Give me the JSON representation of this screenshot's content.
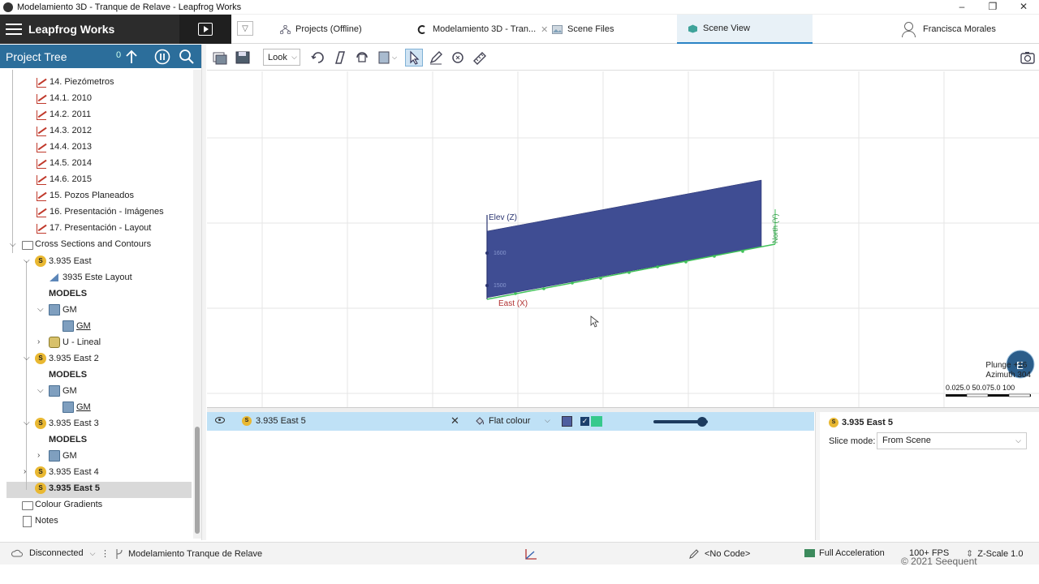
{
  "window": {
    "title": "Modelamiento 3D - Tranque de Relave - Leapfrog Works",
    "controls": [
      "–",
      "❐",
      "✕"
    ]
  },
  "header": {
    "brand": "Leapfrog Works",
    "tabs": {
      "projects": "Projects (Offline)",
      "model": "Modelamiento 3D - Tran...",
      "files": "Scene Files",
      "scene": "Scene View"
    },
    "user": "Francisca Morales"
  },
  "project_tree": {
    "title": "Project Tree",
    "count": "0",
    "items": [
      {
        "label": "14. Piezómetros"
      },
      {
        "label": "14.1. 2010"
      },
      {
        "label": "14.2. 2011"
      },
      {
        "label": "14.3. 2012"
      },
      {
        "label": "14.4. 2013"
      },
      {
        "label": "14.5. 2014"
      },
      {
        "label": "14.6. 2015"
      },
      {
        "label": "15. Pozos Planeados"
      },
      {
        "label": "16. Presentación - Imágenes"
      },
      {
        "label": "17. Presentación - Layout"
      },
      {
        "label": "Cross Sections and Contours"
      },
      {
        "label": "3.935 East"
      },
      {
        "label": "3935 Este Layout"
      },
      {
        "label": "MODELS"
      },
      {
        "label": "GM"
      },
      {
        "label": "GM"
      },
      {
        "label": "U - Lineal"
      },
      {
        "label": "3.935 East 2"
      },
      {
        "label": "MODELS"
      },
      {
        "label": "GM"
      },
      {
        "label": "GM"
      },
      {
        "label": "3.935 East 3"
      },
      {
        "label": "MODELS"
      },
      {
        "label": "GM"
      },
      {
        "label": "3.935 East 4"
      },
      {
        "label": "3.935 East 5"
      },
      {
        "label": "Colour Gradients"
      },
      {
        "label": "Notes"
      }
    ]
  },
  "toolbar": {
    "look": "Look"
  },
  "scene": {
    "axis_elev": "Elev (Z)",
    "axis_east": "East (X)",
    "axis_north": "North (Y)",
    "tick1": "1600",
    "tick2": "1500",
    "plunge": "Plunge +16",
    "azimuth": "Azimuth 304",
    "scale_labels": "0.025.0 50.075.0 100",
    "compass_letter": "E",
    "plane_color": "#3f4d93"
  },
  "shapes": {
    "name": "3.935 East 5",
    "section_badge": "S",
    "mode": "Flat colour",
    "colour": "#4f5fa0",
    "checked": "✓",
    "accent": "#36c98c",
    "opacity": 0.9
  },
  "properties": {
    "title": "3.935 East 5",
    "slice_mode_label": "Slice mode:",
    "slice_mode_value": "From Scene"
  },
  "statusbar": {
    "connection": "Disconnected",
    "project": "Modelamiento Tranque de Relave",
    "code": "<No Code>",
    "acceleration": "Full Acceleration",
    "fps": "100+ FPS",
    "zscale": "Z-Scale 1.0"
  },
  "copyright": "© 2021 Seequent"
}
